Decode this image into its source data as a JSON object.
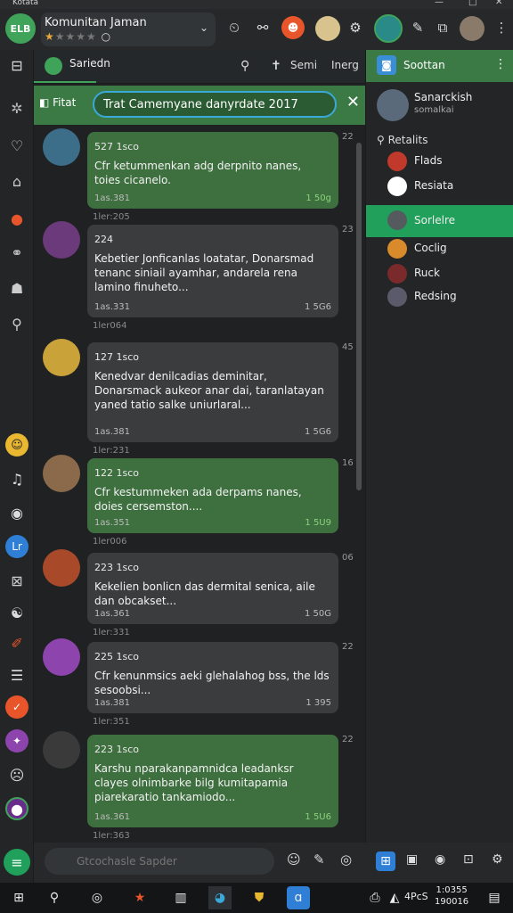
{
  "window": {
    "title": "Kotata",
    "controls": [
      "—",
      "□",
      "✕"
    ]
  },
  "header": {
    "app_icon_text": "ELB",
    "title": "Komunitan Jaman",
    "rating": {
      "filled": 1,
      "total": 5
    }
  },
  "subheader": {
    "tab_label": "Sariedn",
    "item1": "Semi",
    "item2": "Inerg"
  },
  "search": {
    "filter_label": "Fitat",
    "value": "Trat Camemyane danyrdate 2017"
  },
  "messages": [
    {
      "meta": "527 1sco",
      "body": "Cfr ketummenkan adg derpnito nanes, toies cicanelo.",
      "t1": "1as.381",
      "t2": "1 50g",
      "under": "1ler:205",
      "num": "22",
      "color": "green"
    },
    {
      "meta": "224",
      "body": "Kebetier Jonficanlas loatatar, Donarsmad tenanc siniail ayamhar, andarela rena lamino finuheto...",
      "t1": "1as.331",
      "t2": "1 5G6",
      "under": "1ler064",
      "num": "23",
      "color": "grey"
    },
    {
      "meta": "127 1sco",
      "body": "Kenedvar denilcadias deminitar, Donarsmack aukeor anar dai, taranlatayan yaned tatio salke uniurlaral...",
      "t1": "1as.381",
      "t2": "1 5G6",
      "under": "1ler:231",
      "num": "45",
      "color": "grey"
    },
    {
      "meta": "122 1sco",
      "body": "Cfr kestummeken ada derpams nanes, doies cersemston....",
      "t1": "1as.351",
      "t2": "1 5U9",
      "under": "1ler006",
      "num": "16",
      "color": "green"
    },
    {
      "meta": "223 1sco",
      "body": "Kekelien bonlicn das dermital senica, aile dan obcakset...",
      "t1": "1as.361",
      "t2": "1 50G",
      "under": "1ler:331",
      "num": "06",
      "color": "grey"
    },
    {
      "meta": "225 1sco",
      "body": "Cfr kenunmsics aeki glehalahog bss, the lds sesoobsi...",
      "t1": "1as.381",
      "t2": "1 395",
      "under": "1ler:351",
      "num": "22",
      "color": "grey"
    },
    {
      "meta": "223 1sco",
      "body": "Karshu nparakanpamnidca leadanksr clayes olnimbarke bilg kumitapamia piarekaratio tankamiodo...",
      "t1": "1as.361",
      "t2": "1 5U6",
      "under": "1ler:363",
      "num": "22",
      "color": "green"
    }
  ],
  "composer": {
    "placeholder": "Gtcochasle Sapder"
  },
  "right_panel": {
    "header_label": "Soottan",
    "profile_name": "Sanarckish",
    "profile_sub": "somalkai",
    "section_label": "Retalits",
    "items": [
      "Flads",
      "Resiata",
      "Sorlelre",
      "Coclig",
      "Ruck",
      "Redsing"
    ],
    "active_index": 2
  },
  "taskbar": {
    "time": "1:0355",
    "date": "190016",
    "lang": "4PcS"
  },
  "colors": {
    "accent_green": "#3b7a45",
    "active_green": "#21a05b",
    "bubble_green": "#3e6f3f",
    "bubble_grey": "#3a3c3e",
    "search_border": "#3aa8d8"
  }
}
